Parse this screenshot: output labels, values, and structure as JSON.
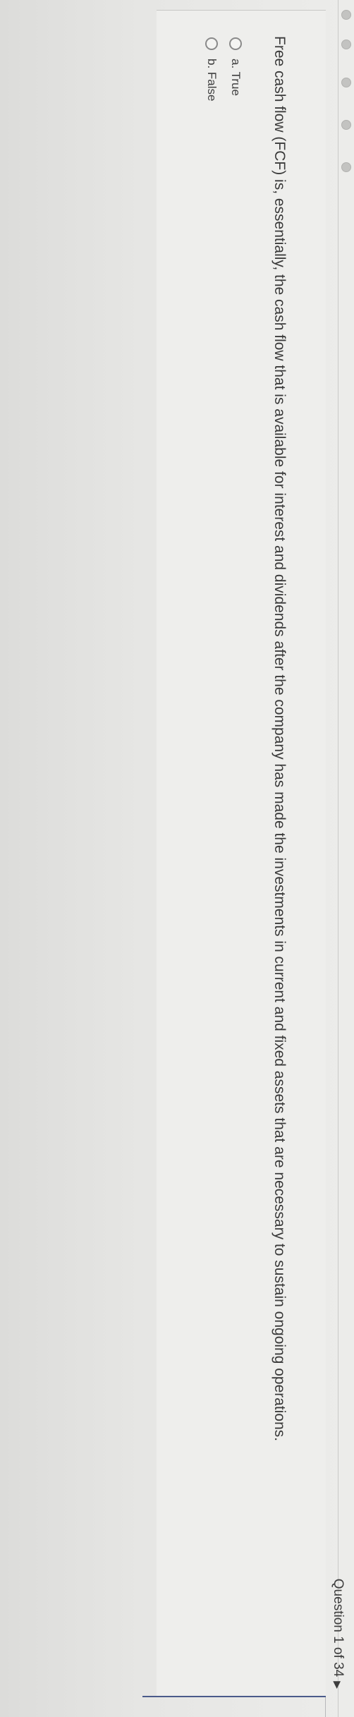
{
  "question": {
    "counter_label": "Question 1 of 34",
    "counter_arrow_icon": "triangle-right",
    "text": "Free cash flow (FCF) is, essentially, the cash flow that is available for interest and dividends after the company has made the investments in current and fixed assets that are necessary to sustain ongoing operations.",
    "options": [
      {
        "label": "a. True",
        "selected": false
      },
      {
        "label": "b. False",
        "selected": false
      }
    ]
  },
  "colors": {
    "accent_line": "#4a5a8a",
    "text": "#3a3a3a"
  }
}
